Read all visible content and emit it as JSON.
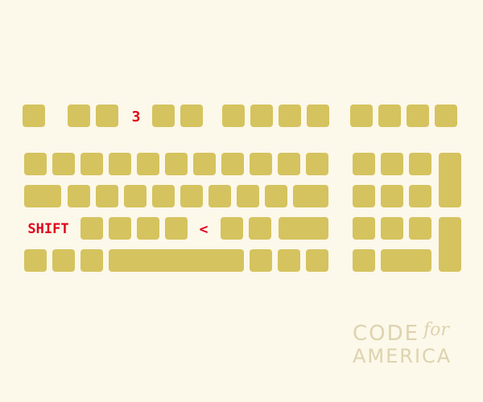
{
  "labels": {
    "digit_three": "3",
    "shift": "SHIFT",
    "less_than": "<"
  },
  "logo": {
    "line1": "CODE",
    "for": "for",
    "line2": "AMERICA"
  },
  "colors": {
    "background": "#fcf8ea",
    "key": "#d5c35f",
    "label": "#e1001a",
    "logo": "#ddd3ae"
  }
}
